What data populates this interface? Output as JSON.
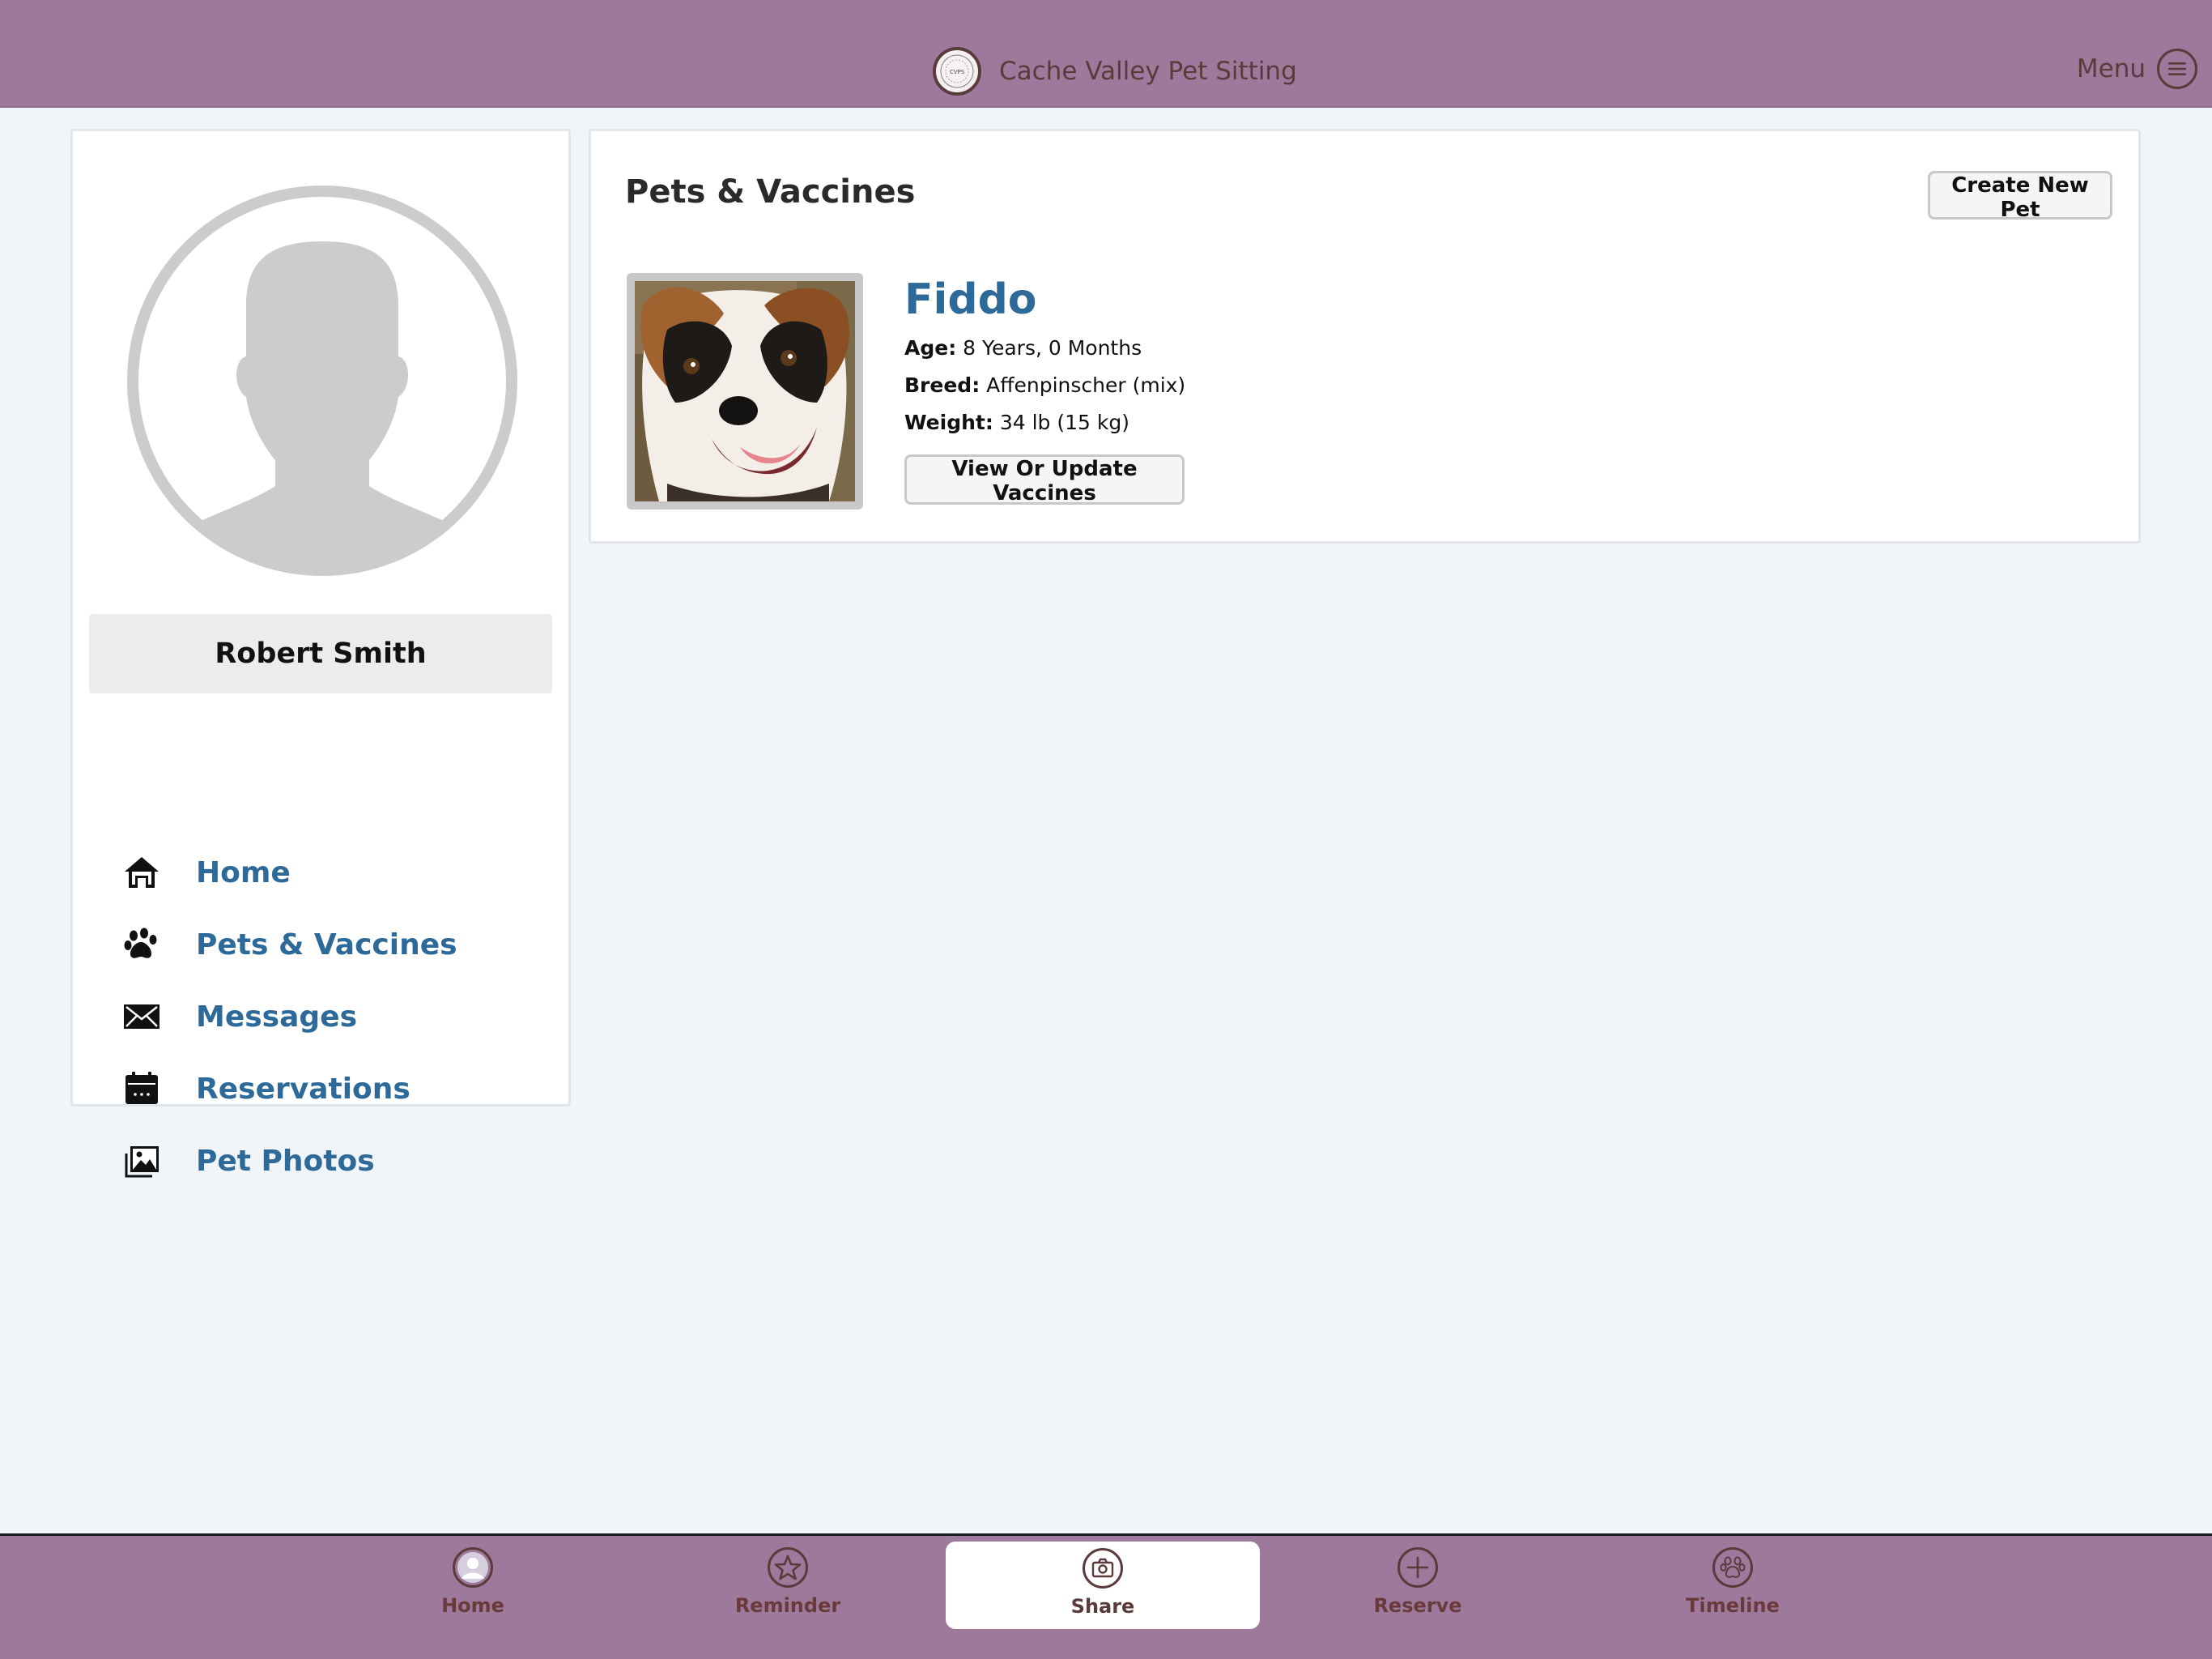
{
  "header": {
    "brand_name": "Cache Valley Pet Sitting",
    "logo_text": "CVPS",
    "menu_label": "Menu"
  },
  "sidebar": {
    "user_name": "Robert Smith",
    "nav": [
      {
        "label": "Home",
        "icon": "home-icon"
      },
      {
        "label": "Pets & Vaccines",
        "icon": "paw-icon"
      },
      {
        "label": "Messages",
        "icon": "envelope-icon"
      },
      {
        "label": "Reservations",
        "icon": "calendar-icon"
      },
      {
        "label": "Pet Photos",
        "icon": "photos-icon"
      }
    ]
  },
  "main": {
    "title": "Pets & Vaccines",
    "create_button": "Create New Pet",
    "pet": {
      "name": "Fiddo",
      "age_label": "Age:",
      "age": "8 Years, 0 Months",
      "breed_label": "Breed:",
      "breed": "Affenpinscher (mix)",
      "weight_label": "Weight:",
      "weight": "34 lb (15 kg)",
      "vaccines_button": "View Or Update Vaccines"
    }
  },
  "tabbar": {
    "tabs": [
      {
        "label": "Home",
        "icon": "person-icon",
        "active": false
      },
      {
        "label": "Reminder",
        "icon": "star-icon",
        "active": false
      },
      {
        "label": "Share",
        "icon": "camera-icon",
        "active": true
      },
      {
        "label": "Reserve",
        "icon": "plus-icon",
        "active": false
      },
      {
        "label": "Timeline",
        "icon": "paw-icon",
        "active": false
      }
    ]
  },
  "colors": {
    "bar": "#9d7a9c",
    "link": "#2d6a9a",
    "background": "#f1f5f8"
  }
}
